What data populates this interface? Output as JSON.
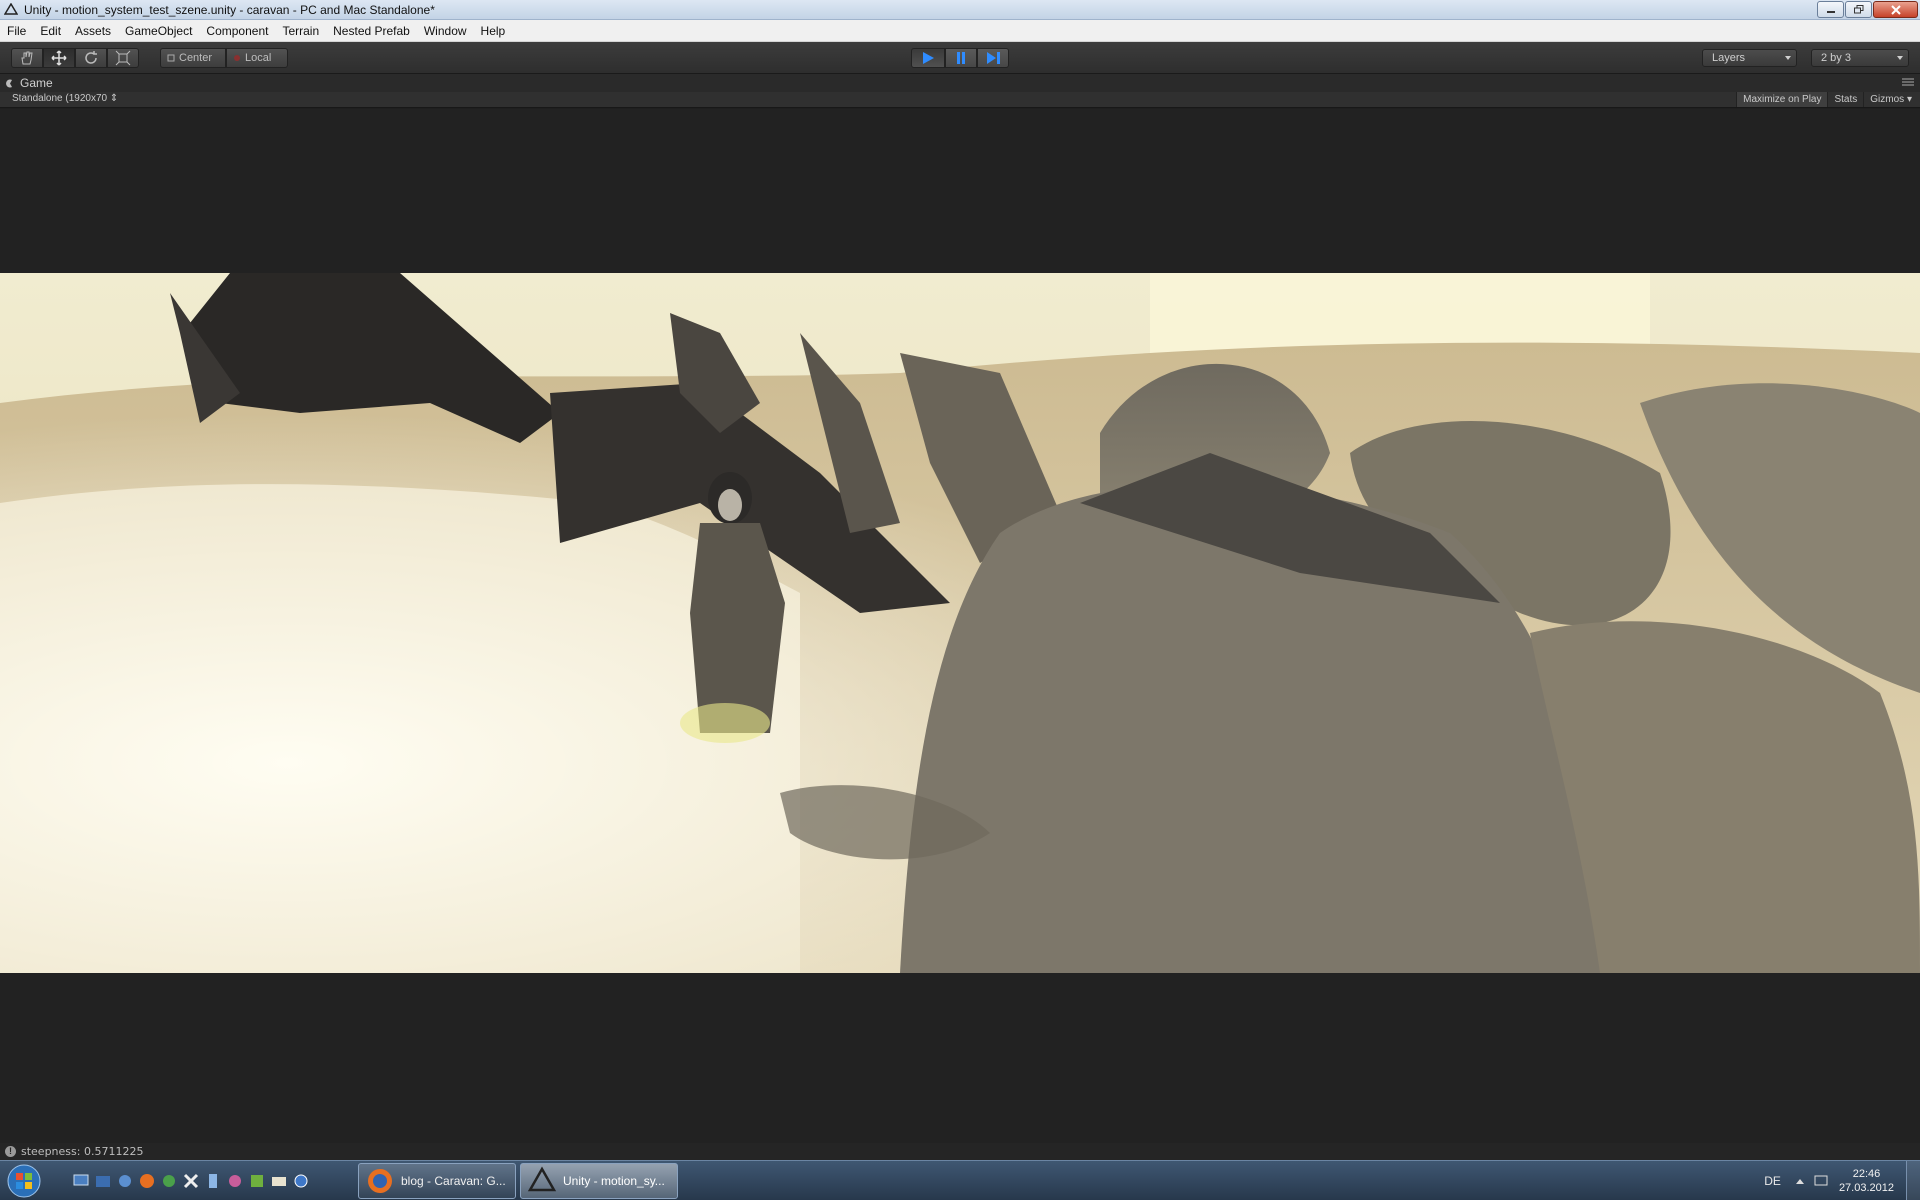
{
  "window": {
    "title": "Unity - motion_system_test_szene.unity - caravan - PC and Mac Standalone*"
  },
  "menu": [
    "File",
    "Edit",
    "Assets",
    "GameObject",
    "Component",
    "Terrain",
    "Nested Prefab",
    "Window",
    "Help"
  ],
  "toolbar": {
    "transform_tools": [
      "hand-icon",
      "move-icon",
      "rotate-icon",
      "scale-icon"
    ],
    "active_tool": "move-icon",
    "pivot_label": "Center",
    "space_label": "Local",
    "play_on": true,
    "layers_label": "Layers",
    "layout_label": "2 by 3"
  },
  "game_view": {
    "tab_label": "Game",
    "aspect_label": "Standalone (1920x70",
    "maximize_label": "Maximize on Play",
    "stats_label": "Stats",
    "gizmos_label": "Gizmos"
  },
  "status": {
    "message": "steepness: 0.5711225"
  },
  "taskbar": {
    "quick_launch": [
      "show-desktop-icon",
      "explorer-icon",
      "network-icon",
      "firefox-icon",
      "app-icon",
      "app-icon",
      "app-icon",
      "app-icon",
      "app-icon",
      "mail-icon",
      "app-icon"
    ],
    "items": [
      {
        "label": "blog - Caravan: G...",
        "icon": "firefox-icon"
      },
      {
        "label": "Unity - motion_sy...",
        "icon": "unity-icon"
      }
    ],
    "language": "DE",
    "time": "22:46",
    "date": "27.03.2012"
  },
  "colors": {
    "editor_bg": "#222222",
    "play_blue": "#2f8cff",
    "taskbar": "#2f4560"
  }
}
